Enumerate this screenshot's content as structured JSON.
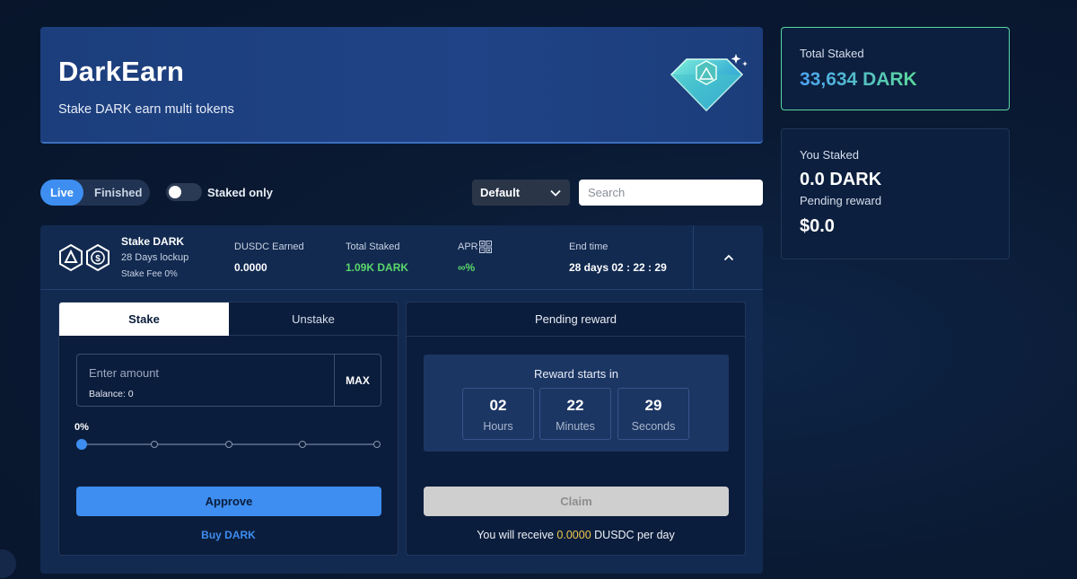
{
  "banner": {
    "title": "DarkEarn",
    "subtitle": "Stake DARK earn multi tokens"
  },
  "stats": {
    "total_staked_label": "Total Staked",
    "total_staked_value": "33,634 DARK",
    "you_staked_label": "You Staked",
    "you_staked_value": "0.0 DARK",
    "pending_reward_label": "Pending reward",
    "pending_reward_value": "$0.0"
  },
  "filters": {
    "live_label": "Live",
    "finished_label": "Finished",
    "staked_only_label": "Staked only",
    "staked_only_on": false,
    "sort_selected": "Default",
    "search_placeholder": "Search"
  },
  "pool": {
    "name": "Stake DARK",
    "lockup": "28 Days lockup",
    "fee": "Stake Fee 0%",
    "earned_label": "DUSDC Earned",
    "earned_value": "0.0000",
    "total_staked_label": "Total Staked",
    "total_staked_value": "1.09K DARK",
    "apr_label": "APR",
    "apr_value": "∞%",
    "end_time_label": "End time",
    "end_time_value": "28 days 02 : 22 : 29"
  },
  "stake_panel": {
    "tab_stake": "Stake",
    "tab_unstake": "Unstake",
    "amount_placeholder": "Enter amount",
    "balance": "Balance: 0",
    "max_label": "MAX",
    "percent": "0%",
    "slider_fraction": 0,
    "approve_label": "Approve",
    "buy_label": "Buy DARK"
  },
  "reward_panel": {
    "title": "Pending reward",
    "countdown_title": "Reward starts in",
    "hours_value": "02",
    "hours_label": "Hours",
    "minutes_value": "22",
    "minutes_label": "Minutes",
    "seconds_value": "29",
    "seconds_label": "Seconds",
    "claim_label": "Claim",
    "receive_prefix": "You will receive",
    "receive_amount": "0.0000",
    "receive_suffix": "DUSDC per day"
  },
  "colors": {
    "accent": "#3d8ef0",
    "positive": "#5bd86a",
    "highlight": "#f2c94c"
  }
}
